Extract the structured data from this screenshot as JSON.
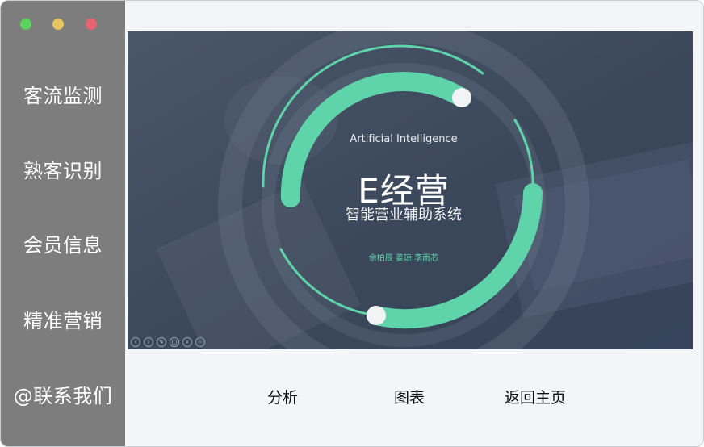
{
  "window": {
    "controls": [
      {
        "name": "close",
        "color": "#5ad35d"
      },
      {
        "name": "minimize",
        "color": "#e8c560"
      },
      {
        "name": "maximize",
        "color": "#e86270"
      }
    ]
  },
  "sidebar": {
    "items": [
      {
        "label": "客流监测"
      },
      {
        "label": "熟客识别"
      },
      {
        "label": "会员信息"
      },
      {
        "label": "精准营销"
      },
      {
        "label": "@联系我们"
      }
    ]
  },
  "slide": {
    "subtitle_en": "Artificial Intelligence",
    "brand": "E经营",
    "subtitle_cn": "智能营业辅助系统",
    "authors": "余柏辰 姜琼 李雨芯",
    "accent_color": "#5fd3a9",
    "toolbar_icons": [
      "prev-icon",
      "next-icon",
      "pen-icon",
      "copy-icon",
      "zoom-icon",
      "more-icon"
    ],
    "toolbar_glyphs": [
      "‹",
      "›",
      "✎",
      "▢",
      "⌕",
      "⋯"
    ]
  },
  "actions": {
    "analysis": "分析",
    "chart": "图表",
    "home": "返回主页"
  }
}
